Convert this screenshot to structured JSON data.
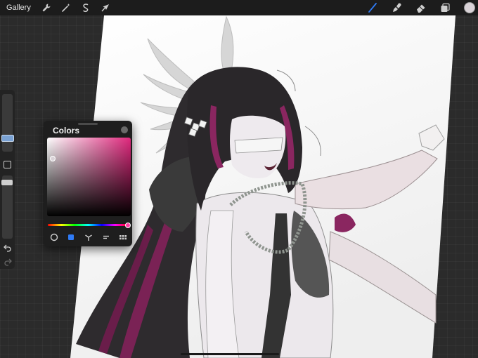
{
  "topbar": {
    "gallery_label": "Gallery",
    "left_tools": [
      "wrench-icon",
      "magic-wand-icon",
      "selection-icon",
      "transform-arrow-icon"
    ],
    "right_tools": [
      "brush-icon",
      "smudge-icon",
      "eraser-icon",
      "layers-icon",
      "color-swatch"
    ],
    "active_tool": "brush-icon",
    "accent_color": "#2f7bf6",
    "current_color": "#d9d2d7"
  },
  "colors_panel": {
    "title": "Colors",
    "hue_color": "#e0287d",
    "tabs": [
      "disc-icon",
      "classic-icon",
      "harmony-icon",
      "value-icon",
      "palettes-icon"
    ],
    "active_tab": "classic-icon"
  },
  "sidebar": {
    "size_level": 0.3,
    "opacity_level": 1.0
  }
}
